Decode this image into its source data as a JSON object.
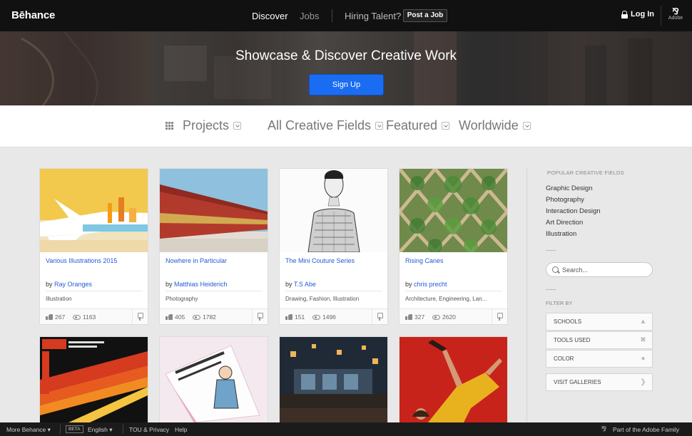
{
  "nav": {
    "logo": "Bēhance",
    "discover": "Discover",
    "jobs": "Jobs",
    "hiring": "Hiring Talent?",
    "post_job": "Post a Job",
    "login": "Log In",
    "adobe": "Adobe"
  },
  "hero": {
    "title": "Showcase & Discover Creative Work",
    "signup": "Sign Up"
  },
  "filters": {
    "projects": "Projects",
    "fields": "All Creative Fields",
    "featured": "Featured",
    "worldwide": "Worldwide"
  },
  "projects": [
    {
      "title": "Various Illustrations 2015",
      "by": "by",
      "author": "Ray Oranges",
      "fields": "Illustration",
      "appreciations": "267",
      "views": "1163"
    },
    {
      "title": "Nowhere in Particular",
      "by": "by",
      "author": "Matthias Heiderich",
      "fields": "Photography",
      "appreciations": "405",
      "views": "1782"
    },
    {
      "title": "The Mini Couture Series",
      "by": "by",
      "author": "T.S Abe",
      "fields": "Drawing, Fashion, Illustration",
      "appreciations": "151",
      "views": "1496"
    },
    {
      "title": "Rising Canes",
      "by": "by",
      "author": "chris precht",
      "fields": "Architecture, Engineering, Lan...",
      "appreciations": "327",
      "views": "2620"
    }
  ],
  "sidebar": {
    "popular_heading": "POPULAR CREATIVE FIELDS",
    "popular_fields": [
      "Graphic Design",
      "Photography",
      "Interaction Design",
      "Art Direction",
      "Illustration"
    ],
    "search_placeholder": "Search...",
    "filter_heading": "FILTER BY",
    "filter_buttons": [
      "SCHOOLS",
      "TOOLS USED",
      "COLOR"
    ],
    "galleries": "VISIT GALLERIES"
  },
  "footer": {
    "more": "More Behance",
    "beta": "BETA",
    "language": "English",
    "tou": "TOU & Privacy",
    "help": "Help",
    "adobe_family": "Part of the Adobe Family"
  },
  "colors": {
    "accent_blue": "#1a6df3",
    "link_blue": "#2559d6",
    "topbar": "#111111"
  }
}
